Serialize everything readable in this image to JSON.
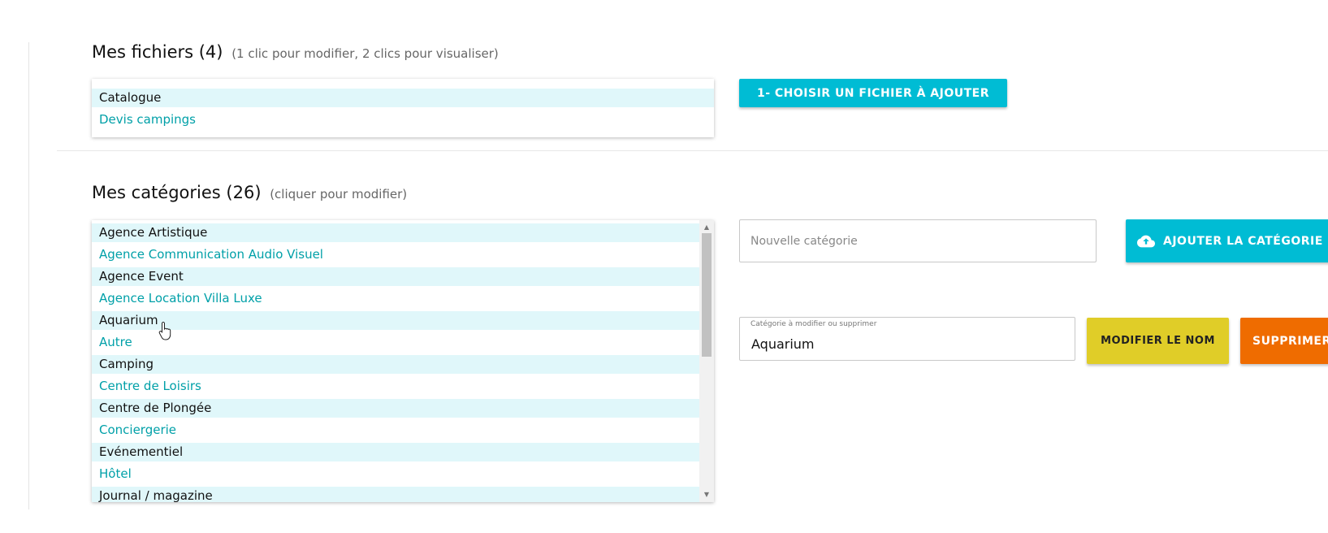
{
  "files": {
    "title": "Mes fichiers (4)",
    "hint": "(1 clic pour modifier, 2 clics pour visualiser)",
    "items": [
      "Catalogue",
      "Devis campings"
    ],
    "choose_button": "1- CHOISIR UN FICHIER À AJOUTER"
  },
  "categories": {
    "title": "Mes catégories (26)",
    "hint": "(cliquer pour modifier)",
    "items": [
      "Agence Artistique",
      "Agence Communication Audio Visuel",
      "Agence Event",
      "Agence Location Villa Luxe",
      "Aquarium",
      "Autre",
      "Camping",
      "Centre de Loisirs",
      "Centre de Plongée",
      "Conciergerie",
      "Evénementiel",
      "Hôtel",
      "Journal / magazine"
    ],
    "new_placeholder": "Nouvelle catégorie",
    "add_button": "AJOUTER LA CATÉGORIE",
    "edit_label": "Catégorie à modifier ou supprimer",
    "edit_value": "Aquarium",
    "rename_button": "MODIFIER LE NOM",
    "delete_button": "SUPPRIMER"
  },
  "colors": {
    "accent": "#00bcd4",
    "rename": "#e0cd28",
    "delete": "#ef6c00",
    "row_alt": "#e0f7fa",
    "link_text": "#00a0a8"
  },
  "icons": {
    "add": "cloud-upload-icon",
    "cursor": "hand-pointer-icon"
  }
}
